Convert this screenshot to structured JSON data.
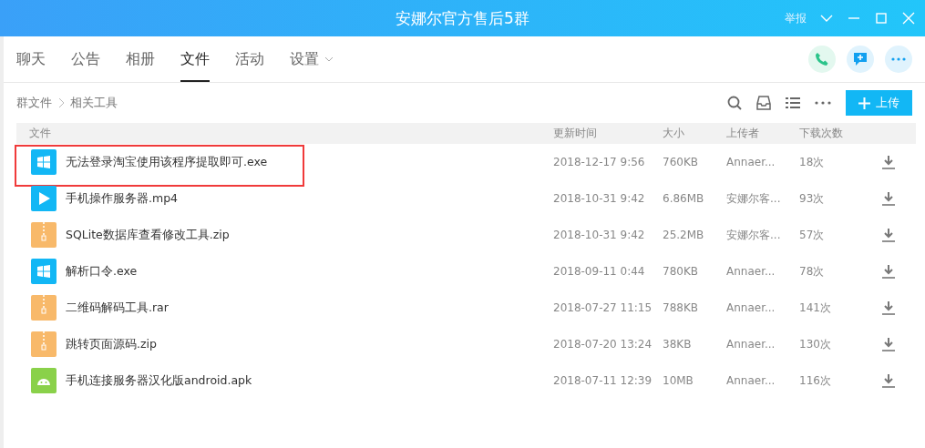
{
  "window": {
    "title": "安娜尔官方售后5群",
    "report": "举报"
  },
  "tabs": [
    {
      "label": "聊天",
      "selected": false
    },
    {
      "label": "公告",
      "selected": false
    },
    {
      "label": "相册",
      "selected": false
    },
    {
      "label": "文件",
      "selected": true
    },
    {
      "label": "活动",
      "selected": false
    },
    {
      "label": "设置",
      "selected": false,
      "dropdown": true
    }
  ],
  "breadcrumb": [
    "群文件",
    "相关工具"
  ],
  "upload_button": "上传",
  "table": {
    "columns": [
      "文件",
      "更新时间",
      "大小",
      "上传者",
      "下载次数"
    ],
    "rows": [
      {
        "kind": "exe",
        "name": "无法登录淘宝使用该程序提取即可.exe",
        "time": "2018-12-17 9:56",
        "size": "760KB",
        "uploader": "Annaer...",
        "downloads": "18次",
        "highlighted": true
      },
      {
        "kind": "video",
        "name": "手机操作服务器.mp4",
        "time": "2018-10-31 9:42",
        "size": "6.86MB",
        "uploader": "安娜尔客...",
        "downloads": "93次",
        "highlighted": false
      },
      {
        "kind": "archive",
        "name": "SQLite数据库查看修改工具.zip",
        "time": "2018-10-31 9:42",
        "size": "25.2MB",
        "uploader": "安娜尔客...",
        "downloads": "57次",
        "highlighted": false
      },
      {
        "kind": "exe",
        "name": "解析口令.exe",
        "time": "2018-09-11 0:44",
        "size": "780KB",
        "uploader": "Annaer...",
        "downloads": "78次",
        "highlighted": false
      },
      {
        "kind": "archive",
        "name": "二维码解码工具.rar",
        "time": "2018-07-27 11:15",
        "size": "788KB",
        "uploader": "Annaer...",
        "downloads": "141次",
        "highlighted": false
      },
      {
        "kind": "archive",
        "name": "跳转页面源码.zip",
        "time": "2018-07-20 13:24",
        "size": "38KB",
        "uploader": "Annaer...",
        "downloads": "130次",
        "highlighted": false
      },
      {
        "kind": "android",
        "name": "手机连接服务器汉化版android.apk",
        "time": "2018-07-11 12:39",
        "size": "10MB",
        "uploader": "Annaer...",
        "downloads": "116次",
        "highlighted": false
      }
    ]
  }
}
